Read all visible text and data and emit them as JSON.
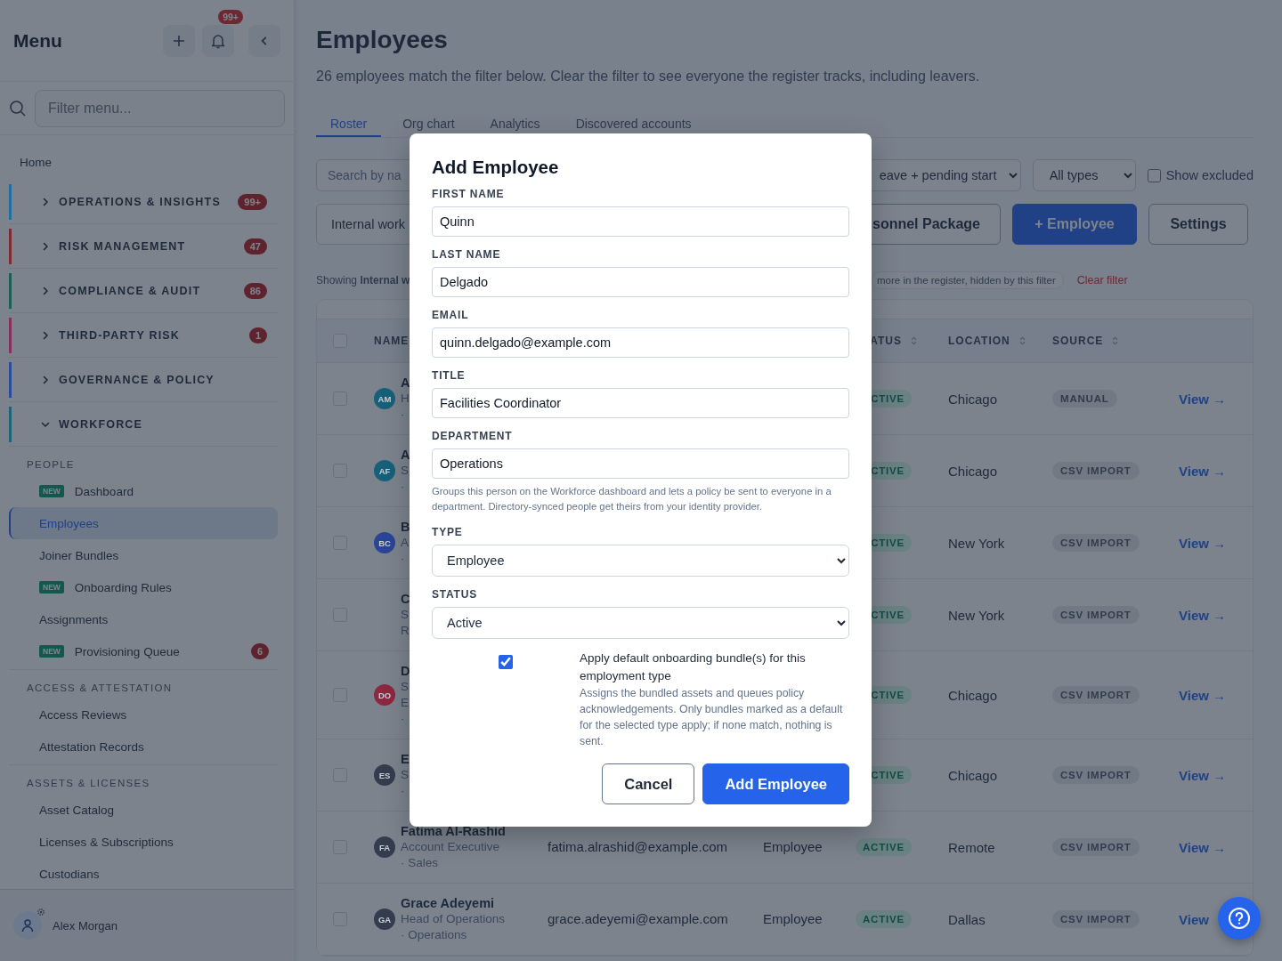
{
  "sidebar": {
    "title": "Menu",
    "notification_badge": "99+",
    "filter": {
      "placeholder": "Filter menu..."
    },
    "home": "Home",
    "sections": [
      {
        "label": "OPERATIONS & INSIGHTS",
        "badge": "99+",
        "color": "#1f6fa3",
        "expanded": false
      },
      {
        "label": "RISK MANAGEMENT",
        "badge": "47",
        "color": "#7f2a33",
        "expanded": false
      },
      {
        "label": "COMPLIANCE & AUDIT",
        "badge": "86",
        "color": "#1d5e54",
        "expanded": false
      },
      {
        "label": "THIRD-PARTY RISK",
        "badge": "1",
        "color": "#85305f",
        "expanded": false
      },
      {
        "label": "GOVERNANCE & POLICY",
        "color": "#2a4a9a",
        "expanded": false
      },
      {
        "label": "WORKFORCE",
        "color": "#1f6377",
        "expanded": true,
        "children": [
          {
            "heading": "PEOPLE",
            "children": [
              {
                "label": "Dashboard",
                "tag": "NEW",
                "selected": false
              },
              {
                "label": "Employees",
                "selected": true
              },
              {
                "label": "Joiner Bundles",
                "selected": false
              },
              {
                "label": "Onboarding Rules",
                "tag": "NEW",
                "selected": false
              },
              {
                "label": "Assignments",
                "selected": false
              },
              {
                "label": "Provisioning Queue",
                "tag": "NEW",
                "badge": "6",
                "selected": false
              }
            ]
          },
          {
            "heading": "ACCESS & ATTESTATION",
            "children": [
              {
                "label": "Access Reviews",
                "selected": false
              },
              {
                "label": "Attestation Records",
                "selected": false
              }
            ]
          },
          {
            "heading": "ASSETS & LICENSES",
            "children": [
              {
                "label": "Asset Catalog",
                "selected": false
              },
              {
                "label": "Licenses & Subscriptions",
                "selected": false
              },
              {
                "label": "Custodians",
                "selected": false
              }
            ]
          }
        ]
      }
    ],
    "user": {
      "name": "Alex Morgan"
    }
  },
  "main": {
    "title": "Employees",
    "subtitle": "26 employees match the filter below. Clear the filter to see everyone the register tracks, including leavers.",
    "tabs": [
      {
        "label": "Roster",
        "selected": true
      },
      {
        "label": "Org chart",
        "selected": false
      },
      {
        "label": "Analytics",
        "selected": false
      },
      {
        "label": "Discovered accounts",
        "selected": false
      }
    ],
    "filters": {
      "search_placeholder": "Search by na",
      "status_select": "eave + pending start",
      "type_select": "All types",
      "show_excluded": {
        "label": "Show excluded",
        "checked": false
      }
    },
    "toolbar": {
      "view_field": "Internal work",
      "buttons": [
        {
          "label": "sonnel Package",
          "kind": "secondary"
        },
        {
          "label": "+ Employee",
          "kind": "primary"
        },
        {
          "label": "Settings",
          "kind": "secondary"
        }
      ]
    },
    "filter_note": {
      "text": "Showing **Internal w**",
      "hidden_chip": "more in the register, hidden by this filter",
      "clear_link": "Clear filter"
    },
    "table": {
      "select_all_checked": false,
      "columns": [
        {
          "label": "NAME",
          "sortable": false
        },
        {
          "label": "ATUS",
          "sortable": true
        },
        {
          "label": "LOCATION",
          "sortable": true
        },
        {
          "label": "SOURCE",
          "sortable": true
        }
      ],
      "rows": [
        {
          "checked": false,
          "avatar": "AM",
          "color": "#17607a",
          "name": "A",
          "details": [
            "H",
            "·"
          ],
          "status": "CTIVE",
          "location": "Chicago",
          "source": "MANUAL",
          "action": "View →"
        },
        {
          "checked": false,
          "avatar": "AF",
          "color": "#17607a",
          "name": "A",
          "details": [
            "S",
            "·"
          ],
          "status": "CTIVE",
          "location": "Chicago",
          "source": "CSV IMPORT",
          "action": "View →"
        },
        {
          "checked": false,
          "avatar": "BC",
          "color": "#2a4596",
          "name": "B",
          "details": [
            "A",
            "·"
          ],
          "status": "CTIVE",
          "location": "New York",
          "source": "CSV IMPORT",
          "action": "View →"
        },
        {
          "checked": false,
          "name": "C",
          "details": [
            "S",
            "R"
          ],
          "status": "CTIVE",
          "location": "New York",
          "source": "CSV IMPORT",
          "action": "View →"
        },
        {
          "checked": false,
          "avatar": "DO",
          "color": "#8c2840",
          "name": "D",
          "details": [
            "S",
            "E",
            "·"
          ],
          "status": "CTIVE",
          "location": "Chicago",
          "source": "CSV IMPORT",
          "action": "View →"
        },
        {
          "checked": false,
          "avatar": "ES",
          "color": "#333d4e",
          "name": "E",
          "details": [
            "S",
            "·"
          ],
          "status": "CTIVE",
          "location": "Chicago",
          "source": "CSV IMPORT",
          "action": "View →"
        },
        {
          "checked": false,
          "avatar": "FA",
          "color": "#333d4e",
          "name": "Fatima Al-Rashid",
          "details": [
            "Account Executive",
            "· Sales"
          ],
          "email": "fatima.alrashid@example.com",
          "type": "Employee",
          "status": "ACTIVE",
          "location": "Remote",
          "source": "CSV IMPORT",
          "action": "View →"
        },
        {
          "checked": false,
          "avatar": "GA",
          "color": "#333d4e",
          "name": "Grace Adeyemi",
          "details": [
            "Head of Operations",
            "· Operations"
          ],
          "email": "grace.adeyemi@example.com",
          "type": "Employee",
          "status": "ACTIVE",
          "location": "Dallas",
          "source": "CSV IMPORT",
          "action": "View"
        }
      ]
    }
  },
  "dialog": {
    "title": "Add Employee",
    "fields": [
      {
        "label": "FIRST NAME",
        "value": "Quinn",
        "kind": "text"
      },
      {
        "label": "LAST NAME",
        "value": "Delgado",
        "kind": "text"
      },
      {
        "label": "EMAIL",
        "value": "quinn.delgado@example.com",
        "kind": "text"
      },
      {
        "label": "TITLE",
        "value": "Facilities Coordinator",
        "kind": "text"
      },
      {
        "label": "DEPARTMENT",
        "value": "Operations",
        "kind": "text",
        "help": "Groups this person on the Workforce dashboard and lets a policy be sent to everyone in a department. Directory-synced people get theirs from your identity provider."
      },
      {
        "label": "TYPE",
        "value": "Employee",
        "kind": "select"
      },
      {
        "label": "STATUS",
        "value": "Active",
        "kind": "select"
      }
    ],
    "checkbox": {
      "checked": true,
      "label": "Apply default onboarding bundle(s) for this employment type",
      "help": "Assigns the bundled assets and queues policy acknowledgements. Only bundles marked as a default for the selected type apply; if none match, nothing is sent."
    },
    "buttons": [
      {
        "label": "Cancel",
        "kind": "secondary"
      },
      {
        "label": "Add Employee",
        "kind": "primary"
      }
    ]
  }
}
